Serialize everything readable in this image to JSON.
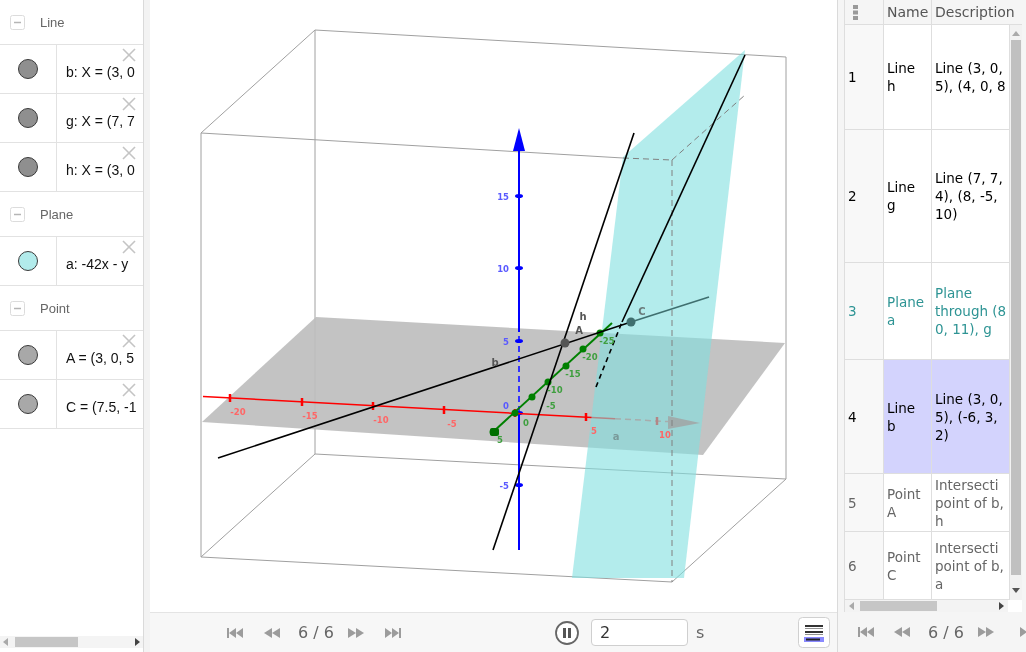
{
  "algebra_view": {
    "groups": [
      {
        "title": "Line",
        "expanded": true,
        "items": [
          {
            "text": "b: X = (3, 0",
            "color": "#8f8f8f"
          },
          {
            "text": "g: X = (7, 7",
            "color": "#8f8f8f"
          },
          {
            "text": "h: X = (3, 0",
            "color": "#8f8f8f"
          }
        ]
      },
      {
        "title": "Plane",
        "expanded": true,
        "items": [
          {
            "text": "a: -42x - y",
            "color": "#b2ebeb"
          }
        ]
      },
      {
        "title": "Point",
        "expanded": true,
        "items": [
          {
            "text": "A = (3, 0, 5",
            "color": "#a8a8a8"
          },
          {
            "text": "C = (7.5, -1",
            "color": "#a8a8a8"
          }
        ]
      }
    ]
  },
  "view_3d": {
    "z_axis_ticks": [
      "15",
      "10",
      "5",
      "0",
      "-5"
    ],
    "x_axis_ticks": [
      "-20",
      "-15",
      "-10",
      "-5",
      "5",
      "10"
    ],
    "y_axis_ticks": [
      "5",
      "0",
      "-5",
      "-10",
      "-15",
      "-20",
      "-25"
    ],
    "object_labels": [
      "h",
      "b",
      "A",
      "C",
      "a"
    ]
  },
  "playback_bar": {
    "step": "6 / 6",
    "playing": true,
    "duration": "2",
    "unit": "s"
  },
  "construction_protocol": {
    "columns": [
      "Name",
      "Description"
    ],
    "rows": [
      {
        "number": "1",
        "name": "Line h",
        "description": "Line (3, 0,\n5), (4, 0, 8",
        "color": "#000000",
        "selected": false
      },
      {
        "number": "2",
        "name": "Line g",
        "description": "Line (7, 7,\n4), (8, -5,\n10)",
        "color": "#000000",
        "selected": false
      },
      {
        "number": "3",
        "name": "Plane a",
        "description": "Plane\nthrough (8\n0, 11), g",
        "color": "#2e9494",
        "selected": false
      },
      {
        "number": "4",
        "name": "Line b",
        "description": "Line (3, 0,\n5), (-6, 3,\n2)",
        "color": "#000000",
        "selected": true
      },
      {
        "number": "5",
        "name": "Point A",
        "description": "Intersecti\npoint of b,\nh",
        "color": "#666666",
        "selected": false
      },
      {
        "number": "6",
        "name": "Point C",
        "description": "Intersecti\npoint of b,\na",
        "color": "#666666",
        "selected": false
      }
    ],
    "step": "6 / 6"
  }
}
